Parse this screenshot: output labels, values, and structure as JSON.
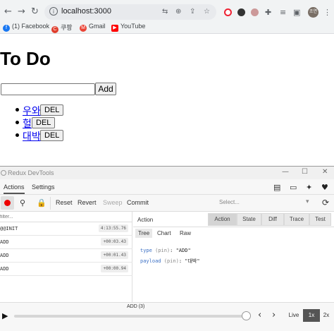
{
  "browser": {
    "url": "localhost:3000",
    "nav": {
      "back": "←",
      "forward": "→",
      "reload": "↻"
    },
    "omni_icons": [
      "translate-icon",
      "zoom-icon",
      "share-icon",
      "star-icon"
    ],
    "toolbar_icons": [
      "puzzle-icon",
      "media-icon",
      "sidepanel-icon",
      "menu-icon"
    ],
    "profile_initials": "조연",
    "bookmarks": [
      {
        "label": "(1) Facebook",
        "icon": "facebook-icon",
        "color": "#1877f2",
        "glyph": "f"
      },
      {
        "label": "쿠팡",
        "icon": "coupang-icon",
        "color": "#e03e2d",
        "glyph": "C"
      },
      {
        "label": "Gmail",
        "icon": "gmail-icon",
        "color": "#ea4335",
        "glyph": "M"
      },
      {
        "label": "YouTube",
        "icon": "youtube-icon",
        "color": "#ff0000",
        "glyph": "▶"
      }
    ]
  },
  "app": {
    "title": "To Do",
    "input_value": "",
    "add_label": "Add",
    "todos": [
      {
        "text": "우와",
        "del_label": "DEL"
      },
      {
        "text": "헐",
        "del_label": "DEL"
      },
      {
        "text": "대박",
        "del_label": "DEL"
      }
    ]
  },
  "devtools": {
    "window_title": "Redux DevTools",
    "tabs": [
      "Actions",
      "Settings"
    ],
    "active_tab": "Actions",
    "toolbar": {
      "reset": "Reset",
      "revert": "Revert",
      "sweep": "Sweep",
      "commit": "Commit",
      "select_placeholder": "Select..."
    },
    "filter_placeholder": "filter...",
    "actions": [
      {
        "name": "@@INIT",
        "time": "4:13:55.76"
      },
      {
        "name": "ADD",
        "time": "+00:03.43"
      },
      {
        "name": "ADD",
        "time": "+00:01.43"
      },
      {
        "name": "ADD",
        "time": "+00:00.94"
      }
    ],
    "detail": {
      "label": "Action",
      "segments": [
        "Action",
        "State",
        "Diff",
        "Trace",
        "Test"
      ],
      "active_segment": "Action",
      "subtabs": [
        "Tree",
        "Chart",
        "Raw"
      ],
      "active_subtab": "Tree",
      "tree": [
        {
          "key": "type",
          "pin": "(pin)",
          "value": ": \"ADD\""
        },
        {
          "key": "payload",
          "pin": "(pin)",
          "value": ": \"대박\""
        }
      ]
    },
    "slider": {
      "label": "ADD (3)",
      "position_fraction": 1.0,
      "speeds": [
        "Live",
        "1x",
        "2x"
      ],
      "active_speed": "1x"
    }
  }
}
